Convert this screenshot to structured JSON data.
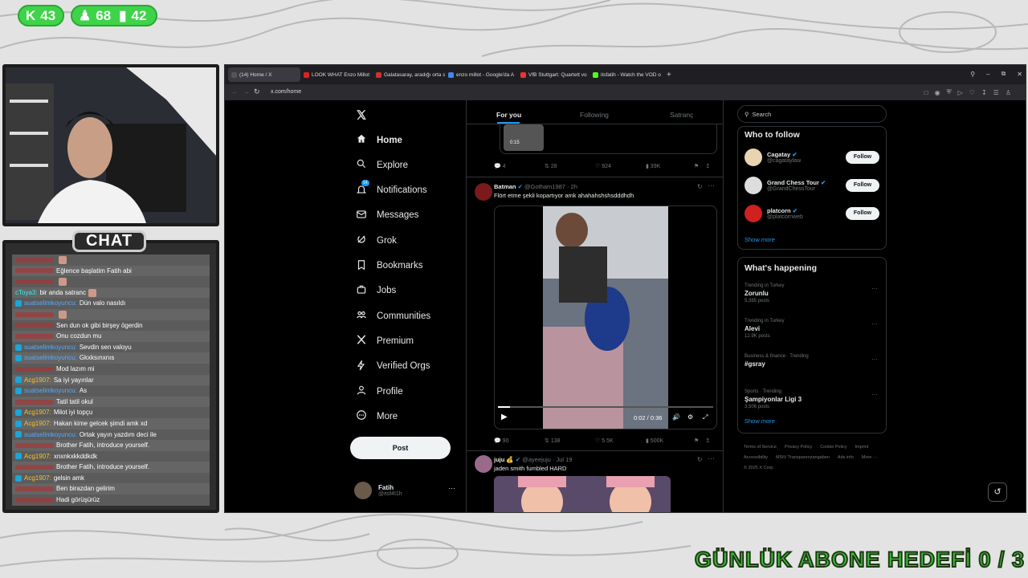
{
  "stream": {
    "stats": [
      {
        "icon": "kick-icon",
        "value": "43"
      },
      {
        "icon": "user-icon",
        "value": "68"
      },
      {
        "icon": "bars-icon",
        "value": "42"
      }
    ],
    "chat_title": "CHAT",
    "goal": "GÜNLÜK ABONE HEDEFİ  0 / 3",
    "accent": "#3fd34a"
  },
  "chat": [
    {
      "user": "",
      "text": "",
      "emote": true
    },
    {
      "user": "",
      "text": "Eğlence başlatim Fatih abi"
    },
    {
      "user": "",
      "text": "",
      "emote": true
    },
    {
      "user": "cToya3:",
      "text": "bir anda satranc",
      "emote_inline": true
    },
    {
      "user": "suatselimkoyuncu:",
      "text": "Dün valo nasıldı",
      "badge": true
    },
    {
      "user": "",
      "text": "",
      "emote": true
    },
    {
      "user": "",
      "text": "Sen dun ok gibi birşey ögerdin"
    },
    {
      "user": "",
      "text": "Onu cozdun mu"
    },
    {
      "user": "suatselimkoyuncu:",
      "text": "Sevdin sen valoyu",
      "badge": true
    },
    {
      "user": "suatselimkoyuncu:",
      "text": "Gkxksınxnıs",
      "badge": true
    },
    {
      "user": "",
      "text": "Mod lazım mi"
    },
    {
      "user": "Acg1907:",
      "text": "Sa iyi yayınlar",
      "badge": true
    },
    {
      "user": "suatselimkoyuncu:",
      "text": "As",
      "badge": true
    },
    {
      "user": "",
      "text": "Tatil tatil okul"
    },
    {
      "user": "Acg1907:",
      "text": "Milot iyi topçu",
      "badge": true
    },
    {
      "user": "Acg1907:",
      "text": "Hakan kime gelcek şimdi amk xd",
      "badge": true
    },
    {
      "user": "suatselimkoyuncu:",
      "text": "Ortak yayın yazdım deci ile",
      "badge": true
    },
    {
      "user": "",
      "text": "Brother Fatih, introduce yourself."
    },
    {
      "user": "Acg1907:",
      "text": "xnxnkxkkddkdk",
      "badge": true
    },
    {
      "user": "",
      "text": "Brother Fatih, introduce yourself."
    },
    {
      "user": "Acg1907:",
      "text": "gelsin amk",
      "badge": true
    },
    {
      "user": "",
      "text": "Ben birazdan gelirim"
    },
    {
      "user": "",
      "text": "Hadi görüşürüz"
    }
  ],
  "browser": {
    "tabs": [
      {
        "label": "(14) Home / X",
        "color": "#555"
      },
      {
        "label": "LOOK WHAT Enzo Millot",
        "color": "#e02020"
      },
      {
        "label": "Galatasaray, aradığı orta s",
        "color": "#d03030"
      },
      {
        "label": "enzo millot - Google'da A",
        "color": "#4285f4"
      },
      {
        "label": "VfB Stuttgart: Quartett vo",
        "color": "#e33"
      },
      {
        "label": "itsfatih - Watch the VOD o",
        "color": "#53fc18"
      }
    ],
    "url": "x.com/home"
  },
  "nav": [
    {
      "icon": "home-icon",
      "label": "Home",
      "active": true
    },
    {
      "icon": "search-icon",
      "label": "Explore"
    },
    {
      "icon": "bell-icon",
      "label": "Notifications",
      "badge": "14"
    },
    {
      "icon": "mail-icon",
      "label": "Messages"
    },
    {
      "icon": "grok-icon",
      "label": "Grok"
    },
    {
      "icon": "bookmark-icon",
      "label": "Bookmarks"
    },
    {
      "icon": "jobs-icon",
      "label": "Jobs"
    },
    {
      "icon": "communities-icon",
      "label": "Communities"
    },
    {
      "icon": "x-icon",
      "label": "Premium"
    },
    {
      "icon": "lightning-icon",
      "label": "Verified Orgs"
    },
    {
      "icon": "person-icon",
      "label": "Profile"
    },
    {
      "icon": "more-icon",
      "label": "More"
    }
  ],
  "post_label": "Post",
  "account": {
    "name": "Fatih",
    "handle": "@itsf4t1h"
  },
  "feed": {
    "tabs": [
      "For you",
      "Following",
      "Satranç"
    ],
    "top_actions": {
      "replies": "4",
      "reposts": "28",
      "likes": "924",
      "views": "39K",
      "duration": "0:15"
    },
    "tweet1": {
      "name": "Batman",
      "handle": "@Gotham1987 · 2h",
      "text": "Flört etme şekli kopartıyor amk ahahahshshsdddhdh",
      "time": "0:02 / 0:36",
      "replies": "90",
      "reposts": "138",
      "likes": "5.5K",
      "views": "500K"
    },
    "tweet2": {
      "name": "juju 💰",
      "handle": "@ayeejuju · Jul 19",
      "text": "jaden smith fumbled HARD"
    }
  },
  "right": {
    "search_placeholder": "Search",
    "who_title": "Who to follow",
    "follow": [
      {
        "name": "Cagatay",
        "handle": "@cagataylaw",
        "color": "#e8d4b0"
      },
      {
        "name": "Grand Chess Tour",
        "handle": "@GrandChessTour",
        "color": "#ddd"
      },
      {
        "name": "platcorn",
        "handle": "@platcornweb",
        "color": "#d02020"
      }
    ],
    "follow_label": "Follow",
    "show_more": "Show more",
    "happening_title": "What's happening",
    "trends": [
      {
        "meta": "Trending in Turkey",
        "name": "Zorunlu",
        "count": "5,385 posts"
      },
      {
        "meta": "Trending in Turkey",
        "name": "Alevi",
        "count": "12.9K posts"
      },
      {
        "meta": "Business & finance · Trending",
        "name": "#gsray",
        "count": ""
      },
      {
        "meta": "Sports · Trending",
        "name": "Şampiyonlar Ligi 3",
        "count": "3,506 posts"
      }
    ],
    "footer": [
      "Terms of Service",
      "Privacy Policy",
      "Cookie Policy",
      "Imprint",
      "Accessibility",
      "MStV Transparenzangaben",
      "Ads info",
      "More ···",
      "© 2025 X Corp."
    ]
  }
}
